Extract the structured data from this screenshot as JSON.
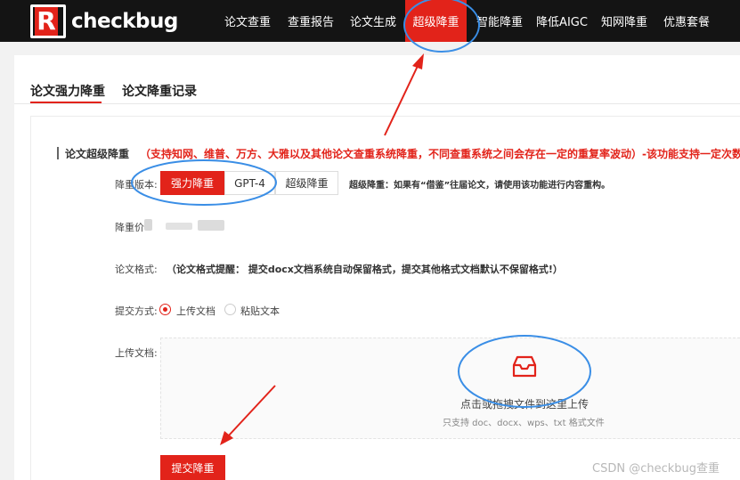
{
  "brand": {
    "logo_letter": "R",
    "name": "checkbug"
  },
  "nav": [
    {
      "label": "论文查重"
    },
    {
      "label": "查重报告"
    },
    {
      "label": "论文生成"
    },
    {
      "label": "超级降重",
      "active": true
    },
    {
      "label": "智能降重"
    },
    {
      "label": "降低AIGC"
    },
    {
      "label": "知网降重"
    },
    {
      "label": "优惠套餐"
    }
  ],
  "tabs": [
    {
      "label": "论文强力降重",
      "active": true
    },
    {
      "label": "论文降重记录"
    }
  ],
  "section": {
    "title": "论文超级降重",
    "note": "（支持知网、维普、万方、大雅以及其他论文查重系统降重，不同查重系统之间会存在一定的重复率波动）-该功能支持一定次数的段"
  },
  "form": {
    "version_label": "降重版本:",
    "modes": [
      {
        "label": "强力降重",
        "selected": true
      },
      {
        "label": "GPT-4"
      },
      {
        "label": "超级降重"
      }
    ],
    "mode_desc": "超级降重：如果有“借鉴”往届论文，请使用该功能进行内容重构。",
    "price_label": "降重价",
    "format_label": "论文格式:",
    "format_text": "（论文格式提醒： 提交docx文档系统自动保留格式，提交其他格式文档默认不保留格式!）",
    "submit_method_label": "提交方式:",
    "submit_methods": [
      {
        "label": "上传文档",
        "checked": true
      },
      {
        "label": "粘贴文本",
        "checked": false
      }
    ],
    "upload_label": "上传文档:",
    "dropzone_main": "点击或拖拽文件到这里上传",
    "dropzone_sub": "只支持 doc、docx、wps、txt 格式文件",
    "submit_button": "提交降重"
  },
  "watermark": "CSDN @checkbug查重",
  "colors": {
    "accent": "#e2231a",
    "annotation": "#3a8ee6",
    "topbar": "#141414"
  },
  "icons": {
    "upload": "inbox-icon"
  }
}
